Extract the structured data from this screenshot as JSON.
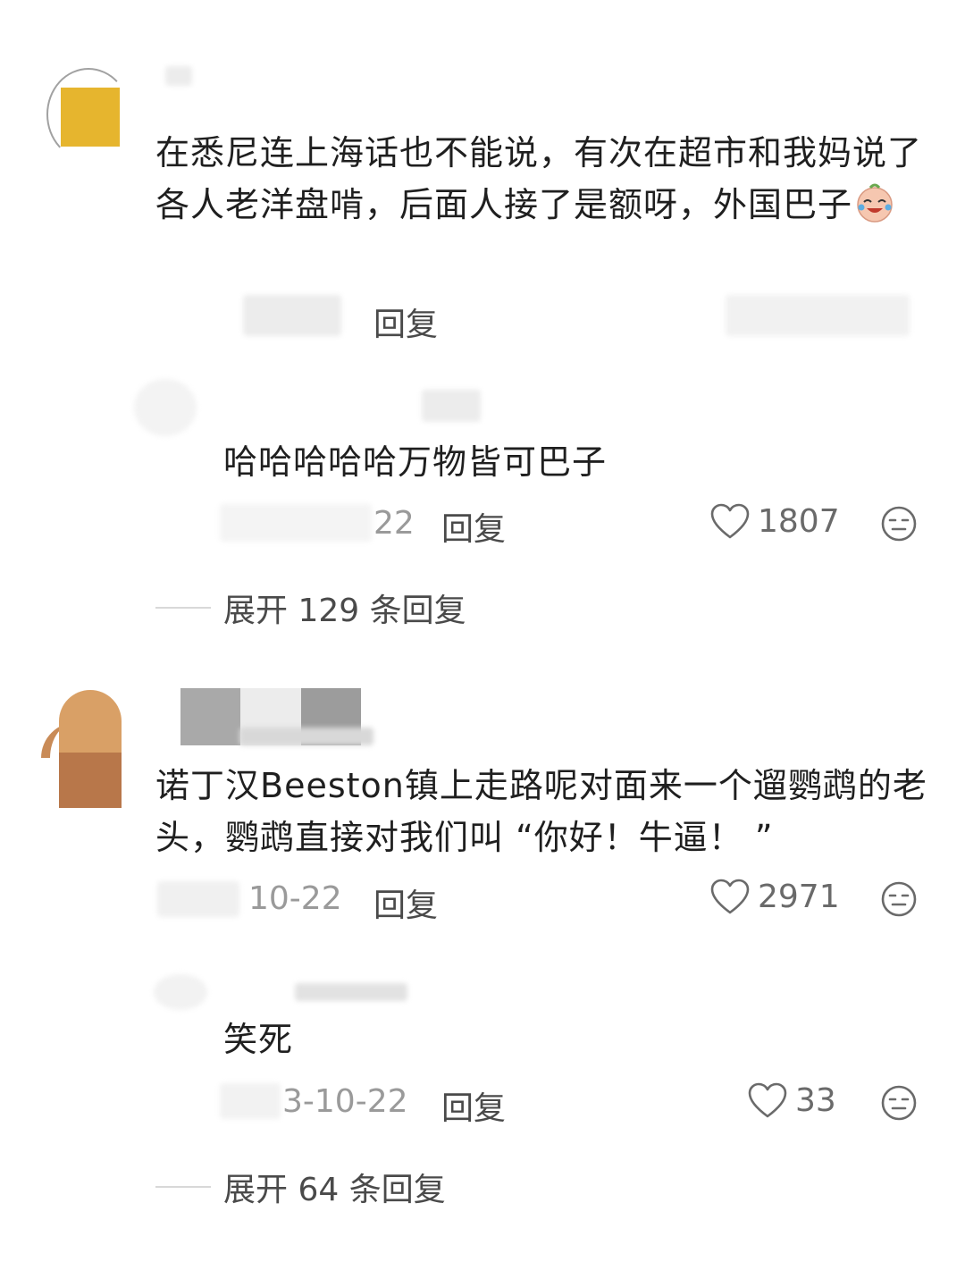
{
  "comments": [
    {
      "text": "在悉尼连上海话也不能说，有次在超市和我妈说了各人老洋盘啃，后面人接了是额呀，外国巴子",
      "reply_label": "回复",
      "emoji": "crying-laughing-emoji",
      "replies": [
        {
          "text": "哈哈哈哈哈万物皆可巴子",
          "date": "22",
          "reply_label": "回复",
          "likes": "1807"
        }
      ],
      "expand_label": "展开 129 条回复"
    },
    {
      "text": "诺丁汉Beeston镇上走路呢对面来一个遛鹦鹉的老头，鹦鹉直接对我们叫 “你好！牛逼！ ”",
      "date": "10-22",
      "reply_label": "回复",
      "likes": "2971",
      "replies": [
        {
          "text": "笑死",
          "date": "3-10-22",
          "reply_label": "回复",
          "likes": "33"
        }
      ],
      "expand_label": "展开 64 条回复"
    }
  ],
  "colors": {
    "text": "#1f1f1f",
    "meta": "#9a9a9a",
    "action": "#4a4a4a",
    "avatar1": "#e6b52e",
    "avatar2_top": "#d9a066",
    "avatar2_bottom": "#b8774a"
  }
}
